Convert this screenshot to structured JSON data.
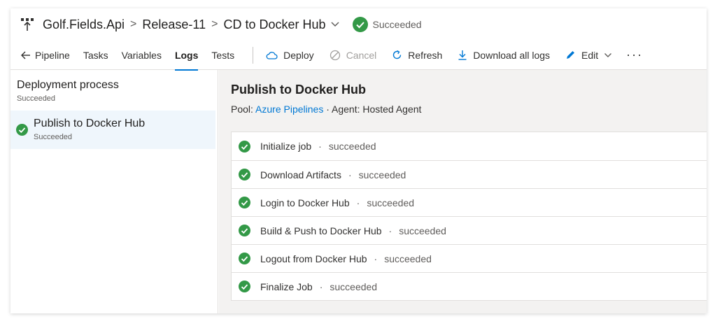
{
  "header": {
    "crumbs": [
      "Golf.Fields.Api",
      "Release-11",
      "CD to Docker Hub"
    ],
    "status": "Succeeded"
  },
  "toolbar": {
    "back_label": "Pipeline",
    "tabs": [
      "Tasks",
      "Variables",
      "Logs",
      "Tests"
    ],
    "active_tab": "Logs",
    "actions": {
      "deploy": "Deploy",
      "cancel": "Cancel",
      "refresh": "Refresh",
      "download": "Download all logs",
      "edit": "Edit"
    },
    "more": "···"
  },
  "left": {
    "process_title": "Deployment process",
    "process_status": "Succeeded",
    "job_title": "Publish to Docker Hub",
    "job_status": "Succeeded"
  },
  "right": {
    "title": "Publish to Docker Hub",
    "pool_label": "Pool:",
    "pool_value": "Azure Pipelines",
    "agent_text": "· Agent: Hosted Agent",
    "steps": [
      {
        "name": "Initialize job",
        "status": "succeeded"
      },
      {
        "name": "Download Artifacts",
        "status": "succeeded"
      },
      {
        "name": "Login to Docker Hub",
        "status": "succeeded"
      },
      {
        "name": "Build & Push to Docker Hub",
        "status": "succeeded"
      },
      {
        "name": "Logout from Docker Hub",
        "status": "succeeded"
      },
      {
        "name": "Finalize Job",
        "status": "succeeded"
      }
    ]
  },
  "colors": {
    "success": "#339947",
    "accent": "#0078d4"
  }
}
